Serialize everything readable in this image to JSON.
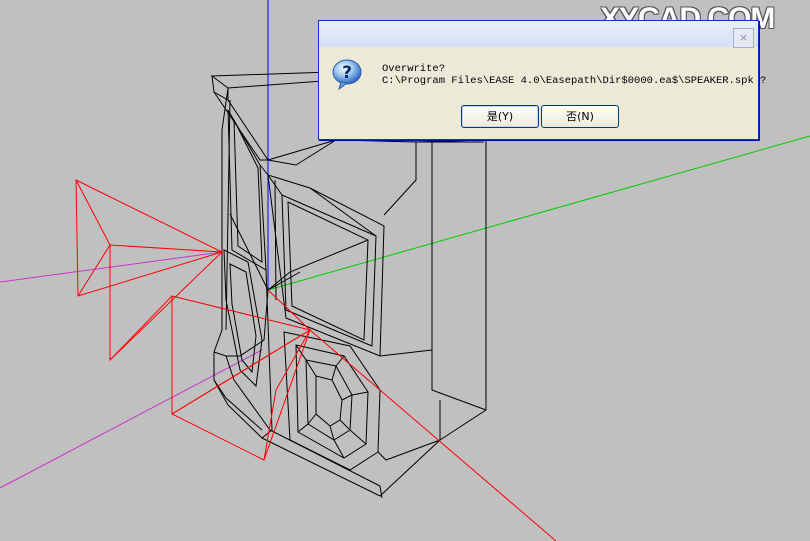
{
  "watermark": {
    "text": "XYCAD.COM"
  },
  "dialog": {
    "close_glyph": "×",
    "icon": "question-icon",
    "message_line1": "Overwrite?",
    "message_line2": "C:\\Program Files\\EASE 4.0\\Easepath\\Dir$0000.ea$\\SPEAKER.spk ?",
    "yes_label": "是(Y)",
    "no_label": "否(N)"
  },
  "colors": {
    "background": "#c0c0c0",
    "model_lines": "#000000",
    "axis_z": "#0000ff",
    "axis_y": "#00cc00",
    "axis_x": "#cc33cc",
    "radiation": "#ff0000"
  }
}
